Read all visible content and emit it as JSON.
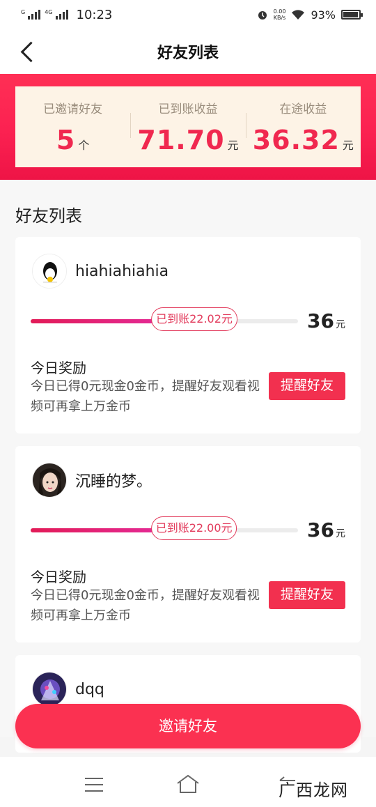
{
  "status_bar": {
    "time": "10:23",
    "network_label": "4G",
    "speed": "0.00",
    "speed_unit": "KB/s",
    "battery": "93%"
  },
  "nav": {
    "title": "好友列表"
  },
  "summary": {
    "invited_label": "已邀请好友",
    "invited_value": "5",
    "invited_unit": "个",
    "received_label": "已到账收益",
    "received_value": "71.70",
    "received_unit": "元",
    "pending_label": "在途收益",
    "pending_value": "36.32",
    "pending_unit": "元"
  },
  "section_title": "好友列表",
  "friends": [
    {
      "name": "hiahiahiahia",
      "progress_label": "已到账22.02元",
      "progress_fraction": 0.612,
      "target": "36",
      "target_unit": "元",
      "reward_title": "今日奖励",
      "reward_desc": "今日已得0元现金0金币，提醒好友观看视频可再拿上万金币",
      "remind_label": "提醒好友"
    },
    {
      "name": "沉睡的梦。",
      "progress_label": "已到账22.00元",
      "progress_fraction": 0.611,
      "target": "36",
      "target_unit": "元",
      "reward_title": "今日奖励",
      "reward_desc": "今日已得0元现金0金币，提醒好友观看视频可再拿上万金币",
      "remind_label": "提醒好友"
    },
    {
      "name": "dqq"
    }
  ],
  "invite_button": "邀请好友",
  "watermark": "广西龙网",
  "colors": {
    "accent": "#f2304f",
    "banner": "#fb2151",
    "stat_bg": "#fdf3e6"
  }
}
